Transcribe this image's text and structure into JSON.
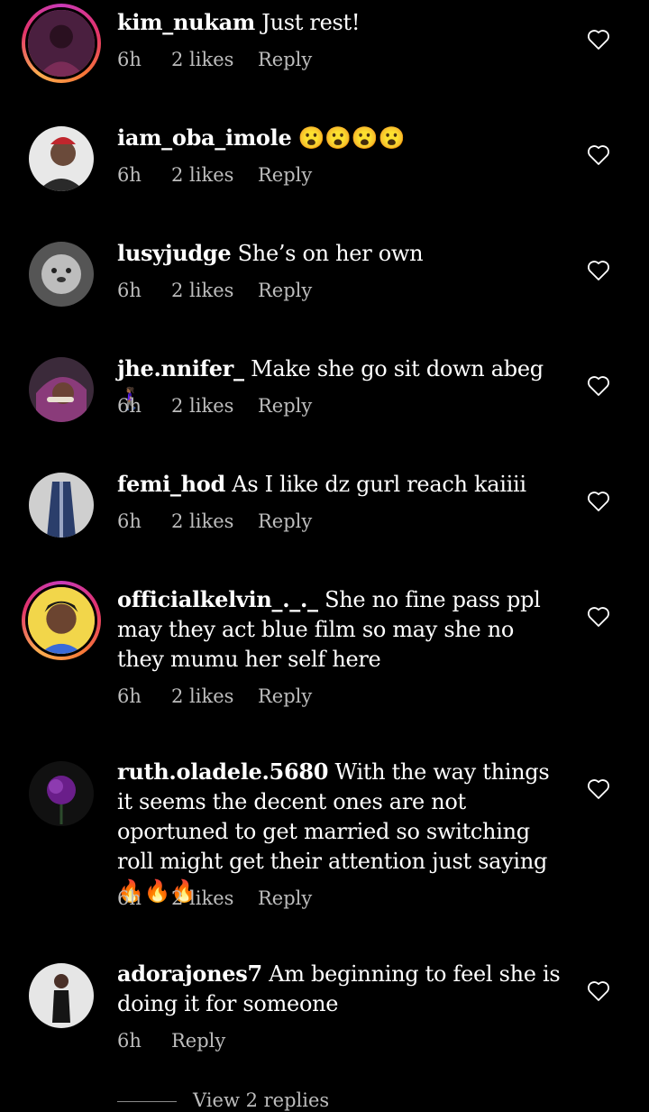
{
  "comments": [
    {
      "username": "kim_nukam",
      "text": "Just rest!",
      "time": "6h",
      "likes": "2 likes",
      "reply": "Reply"
    },
    {
      "username": "iam_oba_imole",
      "text": "😮😮😮😮",
      "time": "6h",
      "likes": "2 likes",
      "reply": "Reply"
    },
    {
      "username": "lusyjudge",
      "text": "She’s on her own",
      "time": "6h",
      "likes": "2 likes",
      "reply": "Reply"
    },
    {
      "username": "jhe.nnifer_",
      "text": "Make she go sit down abeg 🚶🏾‍♀️",
      "time": "6h",
      "likes": "2 likes",
      "reply": "Reply"
    },
    {
      "username": "femi_hod",
      "text": "As I like dz gurl reach kaiiii",
      "time": "6h",
      "likes": "2 likes",
      "reply": "Reply"
    },
    {
      "username": "officialkelvin_._._",
      "text": "She no fine pass ppl may they act blue film so may she no they mumu her self here",
      "time": "6h",
      "likes": "2 likes",
      "reply": "Reply"
    },
    {
      "username": "ruth.oladele.5680",
      "text": "With the way things it seems the decent ones are not oportuned to get married so switching roll might get their attention just saying🔥🔥🔥",
      "time": "6h",
      "likes": "2 likes",
      "reply": "Reply"
    },
    {
      "username": "adorajones7",
      "text": "Am beginning to feel she is doing it for someone",
      "time": "6h",
      "reply": "Reply"
    }
  ],
  "view_replies": "View 2 replies",
  "colors": {
    "background": "#000000",
    "meta": "#bdbdbd",
    "story_ring": "#e2336b"
  }
}
